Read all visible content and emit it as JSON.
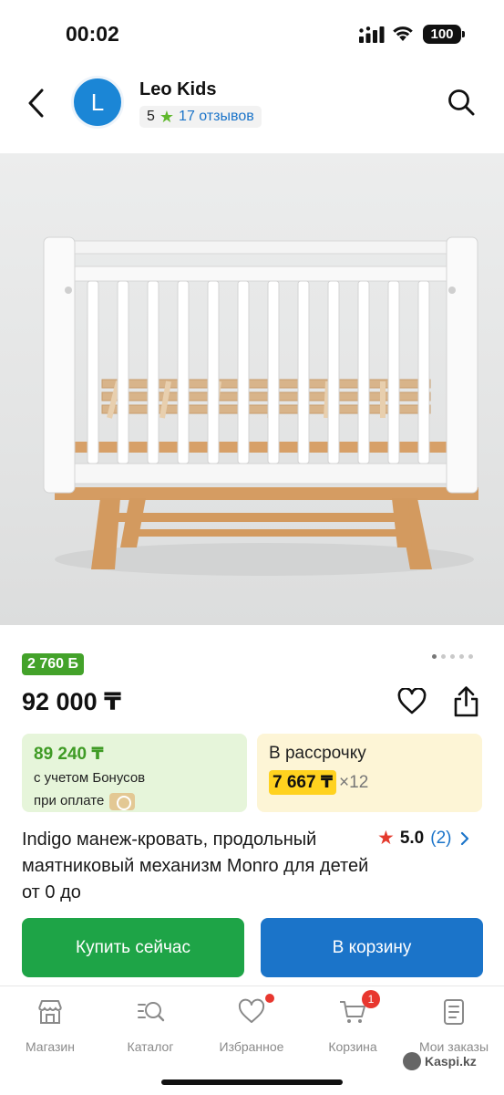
{
  "status_bar": {
    "time": "00:02",
    "battery": "100"
  },
  "header": {
    "avatar_letter": "L",
    "shop_name": "Leo Kids",
    "rating": "5",
    "reviews": "17 отзывов"
  },
  "product": {
    "bonus_badge": "2 760 Б",
    "price": "92 000 ₸",
    "image_dots": 5,
    "active_dot": 0,
    "title": "Indigo манеж-кровать, продольный маятниковый механизм Monro для детей от 0 до",
    "rating_value": "5.0",
    "rating_count": "(2)"
  },
  "bonus_card": {
    "price": "89 240 ₸",
    "line1": "с учетом Бонусов",
    "line2": "при оплате"
  },
  "installment_card": {
    "title": "В рассрочку",
    "amount": "7 667 ₸",
    "multiplier": "×12"
  },
  "actions": {
    "buy_label": "Купить сейчас",
    "cart_label": "В корзину"
  },
  "nav": {
    "items": [
      {
        "label": "Магазин",
        "icon": "shop-icon"
      },
      {
        "label": "Каталог",
        "icon": "catalog-icon"
      },
      {
        "label": "Избранное",
        "icon": "heart-icon"
      },
      {
        "label": "Корзина",
        "icon": "cart-icon",
        "badge": "1"
      },
      {
        "label": "Мои заказы",
        "icon": "orders-icon"
      }
    ]
  },
  "brand": {
    "logo_text": "Kaspi.kz"
  },
  "colors": {
    "accent_blue": "#1b74c9",
    "buy_green": "#1ea447",
    "bonus_green": "#43a22a",
    "installment_yellow": "#ffd21f",
    "alert_red": "#e8372f"
  }
}
